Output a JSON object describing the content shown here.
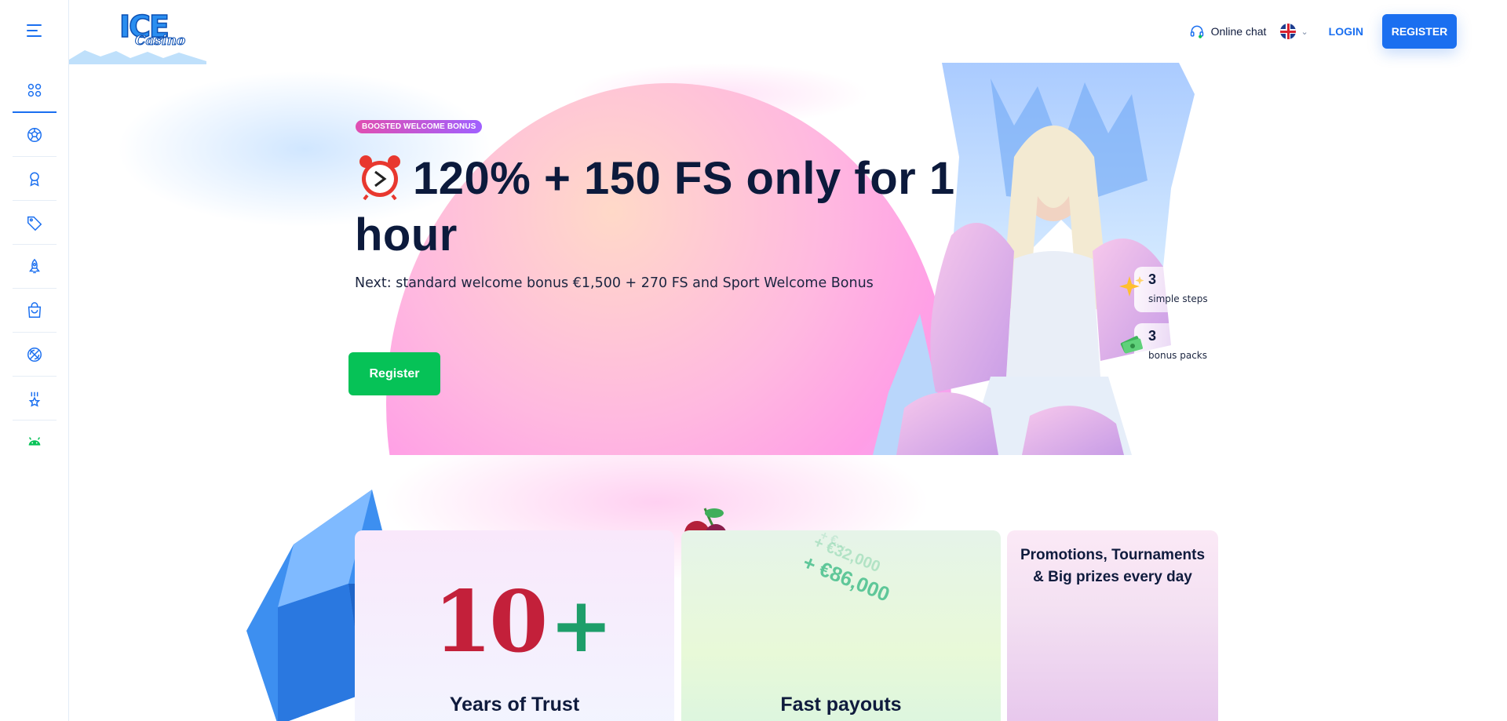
{
  "header": {
    "logo_text": "ICE",
    "logo_sub": "Casino",
    "online_chat": "Online chat",
    "language": "EN",
    "login": "LOGIN",
    "register": "REGISTER"
  },
  "sidebar": {
    "items": [
      {
        "icon": "grid-icon",
        "active": true
      },
      {
        "icon": "soccer-ball-icon"
      },
      {
        "icon": "award-ribbon-icon"
      },
      {
        "icon": "tag-icon"
      },
      {
        "icon": "rocket-icon"
      },
      {
        "icon": "shopping-bag-icon"
      },
      {
        "icon": "basketball-icon"
      },
      {
        "icon": "medal-star-icon"
      },
      {
        "icon": "android-icon"
      }
    ]
  },
  "hero": {
    "badge": "BOOSTED WELCOME BONUS",
    "title_icon": "alarm-clock-icon",
    "title": "120% + 150 FS only for 1 hour",
    "subtitle": "Next: standard welcome bonus €1,500 + 270 FS and Sport Welcome Bonus",
    "cta": "Register",
    "stats": [
      {
        "num": "3",
        "label": "simple steps",
        "icon": "sparkles-icon"
      },
      {
        "num": "3",
        "label": "bonus packs",
        "icon": "money-stack-icon"
      }
    ]
  },
  "cards": [
    {
      "title": "Years of Trust",
      "big": "10",
      "big_plus": "+"
    },
    {
      "title": "Fast payouts",
      "amounts": [
        "+ €86,000",
        "+ €32,000"
      ]
    },
    {
      "title": "Promotions, Tournaments & Big prizes every day"
    }
  ],
  "colors": {
    "accent": "#1a6ff0",
    "cta_green": "#06c257",
    "text_dark": "#0f1b3d"
  }
}
